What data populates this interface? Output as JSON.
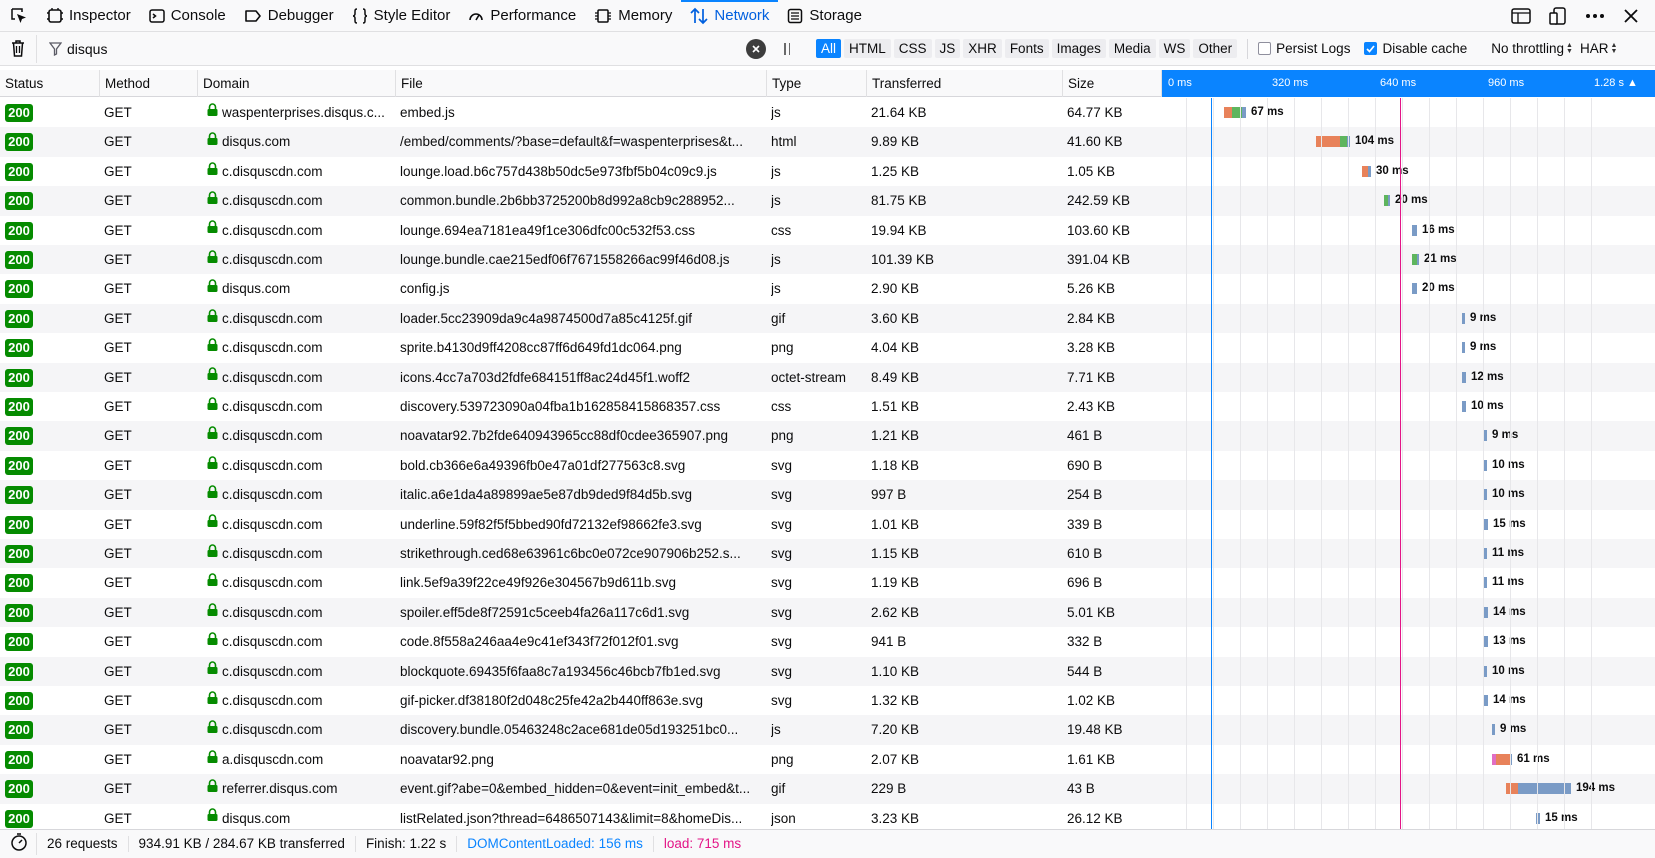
{
  "toolbox": {
    "tabs": [
      {
        "label": "Inspector",
        "icon": "inspector-icon"
      },
      {
        "label": "Console",
        "icon": "console-icon"
      },
      {
        "label": "Debugger",
        "icon": "debugger-icon"
      },
      {
        "label": "Style Editor",
        "icon": "style-editor-icon"
      },
      {
        "label": "Performance",
        "icon": "performance-icon"
      },
      {
        "label": "Memory",
        "icon": "memory-icon"
      },
      {
        "label": "Network",
        "icon": "network-icon"
      },
      {
        "label": "Storage",
        "icon": "storage-icon"
      }
    ],
    "active_tab": "Network",
    "accent": "#0a84ff"
  },
  "toolbar": {
    "filter_value": "disqus",
    "type_filters": [
      "All",
      "HTML",
      "CSS",
      "JS",
      "XHR",
      "Fonts",
      "Images",
      "Media",
      "WS",
      "Other"
    ],
    "active_type": "All",
    "persist_logs": {
      "label": "Persist Logs",
      "checked": false
    },
    "disable_cache": {
      "label": "Disable cache",
      "checked": true
    },
    "throttling": "No throttling",
    "har": "HAR"
  },
  "columns": {
    "status": "Status",
    "method": "Method",
    "domain": "Domain",
    "file": "File",
    "type": "Type",
    "transferred": "Transferred",
    "size": "Size"
  },
  "timeline_ticks": [
    "0 ms",
    "320 ms",
    "640 ms",
    "960 ms",
    "1.28 s ▲"
  ],
  "requests": [
    {
      "status": "200",
      "method": "GET",
      "domain": "waspenterprises.disqus.c...",
      "file": "embed.js",
      "type": "js",
      "transferred": "21.64 KB",
      "size": "64.77 KB",
      "time_label": "67 ms"
    },
    {
      "status": "200",
      "method": "GET",
      "domain": "disqus.com",
      "file": "/embed/comments/?base=default&f=waspenterprises&t...",
      "type": "html",
      "transferred": "9.89 KB",
      "size": "41.60 KB",
      "time_label": "104 ms"
    },
    {
      "status": "200",
      "method": "GET",
      "domain": "c.disquscdn.com",
      "file": "lounge.load.b6c757d438b50dc5e973fbf5b04c09c9.js",
      "type": "js",
      "transferred": "1.25 KB",
      "size": "1.05 KB",
      "time_label": "30 ms"
    },
    {
      "status": "200",
      "method": "GET",
      "domain": "c.disquscdn.com",
      "file": "common.bundle.2b6bb3725200b8d992a8cb9c288952...",
      "type": "js",
      "transferred": "81.75 KB",
      "size": "242.59 KB",
      "time_label": "20 ms"
    },
    {
      "status": "200",
      "method": "GET",
      "domain": "c.disquscdn.com",
      "file": "lounge.694ea7181ea49f1ce306dfc00c532f53.css",
      "type": "css",
      "transferred": "19.94 KB",
      "size": "103.60 KB",
      "time_label": "16 ms"
    },
    {
      "status": "200",
      "method": "GET",
      "domain": "c.disquscdn.com",
      "file": "lounge.bundle.cae215edf06f7671558266ac99f46d08.js",
      "type": "js",
      "transferred": "101.39 KB",
      "size": "391.04 KB",
      "time_label": "21 ms"
    },
    {
      "status": "200",
      "method": "GET",
      "domain": "disqus.com",
      "file": "config.js",
      "type": "js",
      "transferred": "2.90 KB",
      "size": "5.26 KB",
      "time_label": "20 ms"
    },
    {
      "status": "200",
      "method": "GET",
      "domain": "c.disquscdn.com",
      "file": "loader.5cc23909da9c4a9874500d7a85c4125f.gif",
      "type": "gif",
      "transferred": "3.60 KB",
      "size": "2.84 KB",
      "time_label": "9 ms"
    },
    {
      "status": "200",
      "method": "GET",
      "domain": "c.disquscdn.com",
      "file": "sprite.b4130d9ff4208cc87ff6d649fd1dc064.png",
      "type": "png",
      "transferred": "4.04 KB",
      "size": "3.28 KB",
      "time_label": "9 ms"
    },
    {
      "status": "200",
      "method": "GET",
      "domain": "c.disquscdn.com",
      "file": "icons.4cc7a703d2fdfe684151ff8ac24d45f1.woff2",
      "type": "octet-stream",
      "transferred": "8.49 KB",
      "size": "7.71 KB",
      "time_label": "12 ms"
    },
    {
      "status": "200",
      "method": "GET",
      "domain": "c.disquscdn.com",
      "file": "discovery.539723090a04fba1b162858415868357.css",
      "type": "css",
      "transferred": "1.51 KB",
      "size": "2.43 KB",
      "time_label": "10 ms"
    },
    {
      "status": "200",
      "method": "GET",
      "domain": "c.disquscdn.com",
      "file": "noavatar92.7b2fde640943965cc88df0cdee365907.png",
      "type": "png",
      "transferred": "1.21 KB",
      "size": "461 B",
      "time_label": "9 ms"
    },
    {
      "status": "200",
      "method": "GET",
      "domain": "c.disquscdn.com",
      "file": "bold.cb366e6a49396fb0e47a01df277563c8.svg",
      "type": "svg",
      "transferred": "1.18 KB",
      "size": "690 B",
      "time_label": "10 ms"
    },
    {
      "status": "200",
      "method": "GET",
      "domain": "c.disquscdn.com",
      "file": "italic.a6e1da4a89899ae5e87db9ded9f84d5b.svg",
      "type": "svg",
      "transferred": "997 B",
      "size": "254 B",
      "time_label": "10 ms"
    },
    {
      "status": "200",
      "method": "GET",
      "domain": "c.disquscdn.com",
      "file": "underline.59f82f5f5bbed90fd72132ef98662fe3.svg",
      "type": "svg",
      "transferred": "1.01 KB",
      "size": "339 B",
      "time_label": "15 ms"
    },
    {
      "status": "200",
      "method": "GET",
      "domain": "c.disquscdn.com",
      "file": "strikethrough.ced68e63961c6bc0e072ce907906b252.s...",
      "type": "svg",
      "transferred": "1.15 KB",
      "size": "610 B",
      "time_label": "11 ms"
    },
    {
      "status": "200",
      "method": "GET",
      "domain": "c.disquscdn.com",
      "file": "link.5ef9a39f22ce49f926e304567b9d611b.svg",
      "type": "svg",
      "transferred": "1.19 KB",
      "size": "696 B",
      "time_label": "11 ms"
    },
    {
      "status": "200",
      "method": "GET",
      "domain": "c.disquscdn.com",
      "file": "spoiler.eff5de8f72591c5ceeb4fa26a117c6d1.svg",
      "type": "svg",
      "transferred": "2.62 KB",
      "size": "5.01 KB",
      "time_label": "14 ms"
    },
    {
      "status": "200",
      "method": "GET",
      "domain": "c.disquscdn.com",
      "file": "code.8f558a246aa4e9c41ef343f72f012f01.svg",
      "type": "svg",
      "transferred": "941 B",
      "size": "332 B",
      "time_label": "13 ms"
    },
    {
      "status": "200",
      "method": "GET",
      "domain": "c.disquscdn.com",
      "file": "blockquote.69435f6faa8c7a193456c46bcb7fb1ed.svg",
      "type": "svg",
      "transferred": "1.10 KB",
      "size": "544 B",
      "time_label": "10 ms"
    },
    {
      "status": "200",
      "method": "GET",
      "domain": "c.disquscdn.com",
      "file": "gif-picker.df38180f2d048c25fe42a2b440ff863e.svg",
      "type": "svg",
      "transferred": "1.32 KB",
      "size": "1.02 KB",
      "time_label": "14 ms"
    },
    {
      "status": "200",
      "method": "GET",
      "domain": "c.disquscdn.com",
      "file": "discovery.bundle.05463248c2ace681de05d193251bc0...",
      "type": "js",
      "transferred": "7.20 KB",
      "size": "19.48 KB",
      "time_label": "9 ms"
    },
    {
      "status": "200",
      "method": "GET",
      "domain": "a.disquscdn.com",
      "file": "noavatar92.png",
      "type": "png",
      "transferred": "2.07 KB",
      "size": "1.61 KB",
      "time_label": "61 ms"
    },
    {
      "status": "200",
      "method": "GET",
      "domain": "referrer.disqus.com",
      "file": "event.gif?abe=0&embed_hidden=0&event=init_embed&t...",
      "type": "gif",
      "transferred": "229 B",
      "size": "43 B",
      "time_label": "194 ms"
    },
    {
      "status": "200",
      "method": "GET",
      "domain": "disqus.com",
      "file": "listRelated.json?thread=6486507143&limit=8&homeDis...",
      "type": "json",
      "transferred": "3.23 KB",
      "size": "26.12 KB",
      "time_label": "15 ms"
    }
  ],
  "summary": {
    "requests": "26 requests",
    "transferred": "934.91 KB / 284.67 KB transferred",
    "finish": "Finish: 1.22 s",
    "dom_content_loaded": "DOMContentLoaded: 156 ms",
    "load": "load: 715 ms"
  },
  "colors": {
    "status_ok": "#058b00",
    "dom_content_loaded": "#0a84ff",
    "load": "#e31587"
  }
}
